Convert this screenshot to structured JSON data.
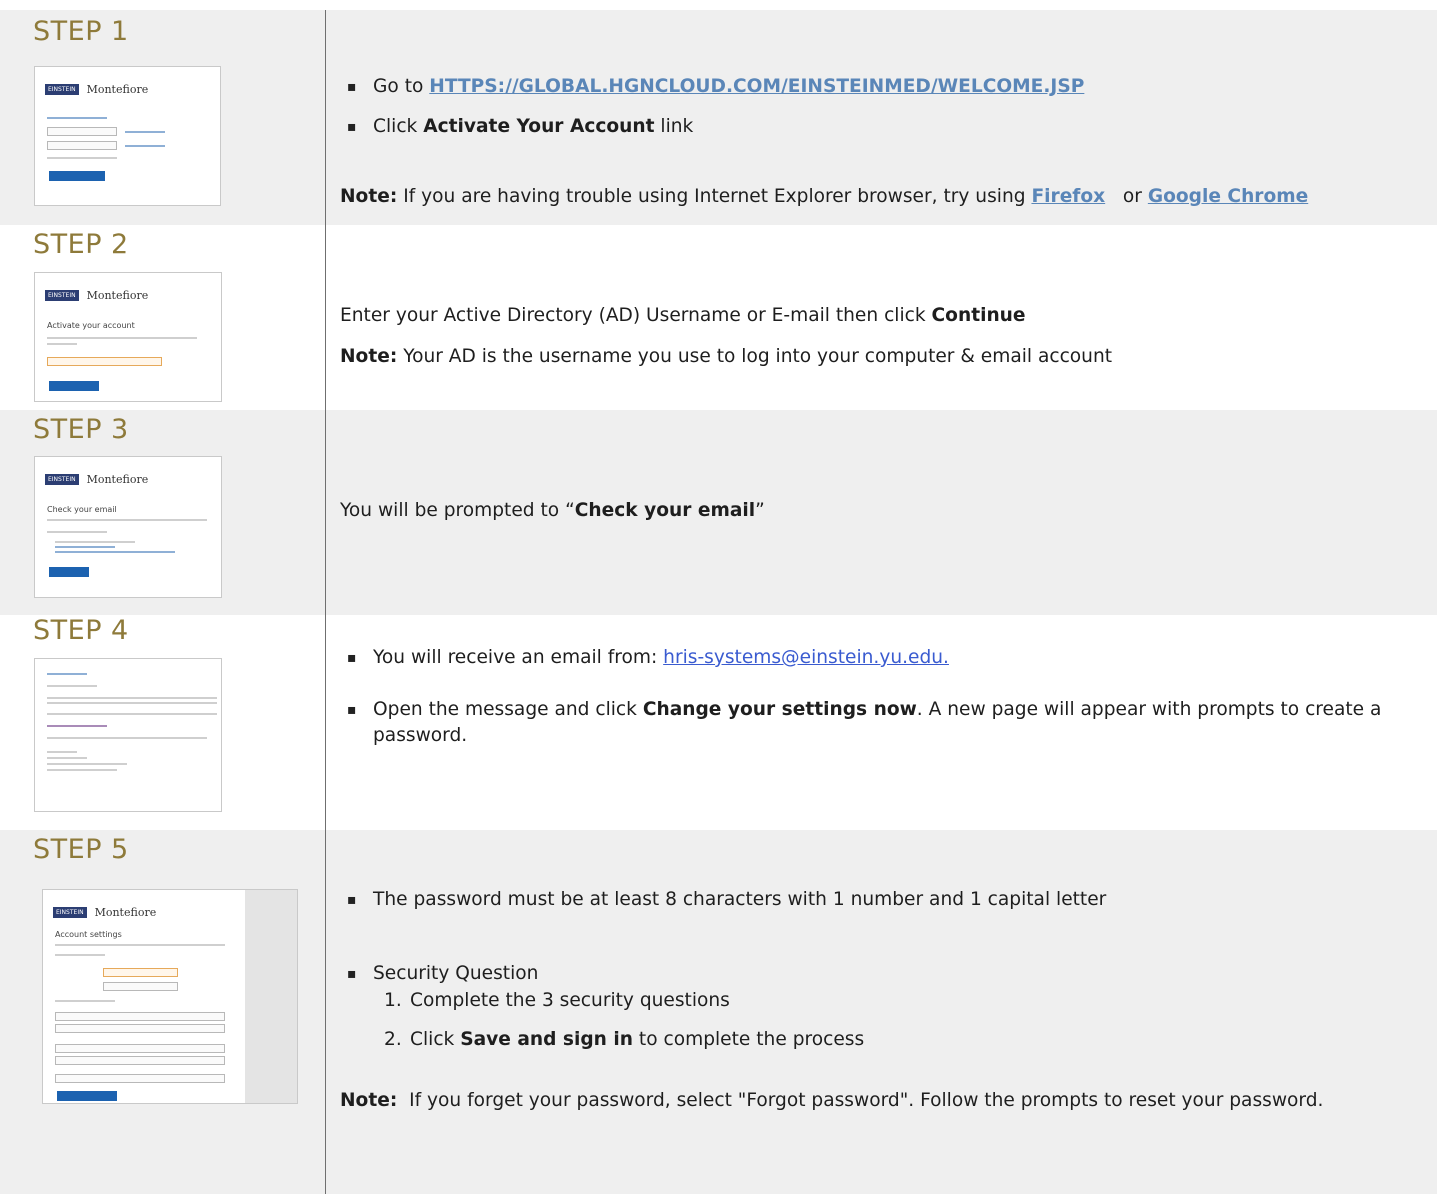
{
  "step1": {
    "title": "STEP 1",
    "thumb_brand": "Montefiore",
    "thumb_logo": "EINSTEIN",
    "b1_prefix": "Go to ",
    "b1_link": "HTTPS://GLOBAL.HGNCLOUD.COM/EINSTEINMED/WELCOME.JSP",
    "b2_prefix": "Click ",
    "b2_bold": "Activate Your Account",
    "b2_suffix": " link",
    "note_label": "Note:",
    "note_text": " If you are having trouble using Internet Explorer browser, try using ",
    "note_link1": "Firefox",
    "note_or": "   or ",
    "note_link2": "Google Chrome"
  },
  "step2": {
    "title": "STEP 2",
    "thumb_brand": "Montefiore",
    "thumb_logo": "EINSTEIN",
    "thumb_heading": "Activate your account",
    "line1_prefix": "Enter your Active Directory (AD) Username or E-mail then click ",
    "line1_bold": "Continue",
    "note_label": "Note:",
    "note_text": " Your AD is the username you use to log into your computer & email account"
  },
  "step3": {
    "title": "STEP 3",
    "thumb_brand": "Montefiore",
    "thumb_logo": "EINSTEIN",
    "thumb_heading": "Check your email",
    "line_prefix": "You will be prompted to “",
    "line_bold": "Check your email",
    "line_suffix": "”"
  },
  "step4": {
    "title": "STEP 4",
    "b1_prefix": "You will receive an email from: ",
    "b1_email": "hris-systems@einstein.yu.edu.",
    "b2_prefix": "Open the message and click ",
    "b2_bold": "Change your settings now",
    "b2_suffix": ". A new page will appear with prompts to create a password."
  },
  "step5": {
    "title": "STEP 5",
    "thumb_brand": "Montefiore",
    "thumb_logo": "EINSTEIN",
    "thumb_heading": "Account settings",
    "b1": "The password must be at least 8 characters with 1 number and 1 capital letter",
    "b2": "Security Question",
    "n1_num": "1.",
    "n1": "Complete the 3 security questions",
    "n2_num": "2.",
    "n2_prefix": "Click ",
    "n2_bold": "Save and sign in",
    "n2_suffix": " to complete the process",
    "note_label": "Note:",
    "note_text": "  If you forget your password, select \"Forgot password\". Follow the prompts to reset your password."
  }
}
